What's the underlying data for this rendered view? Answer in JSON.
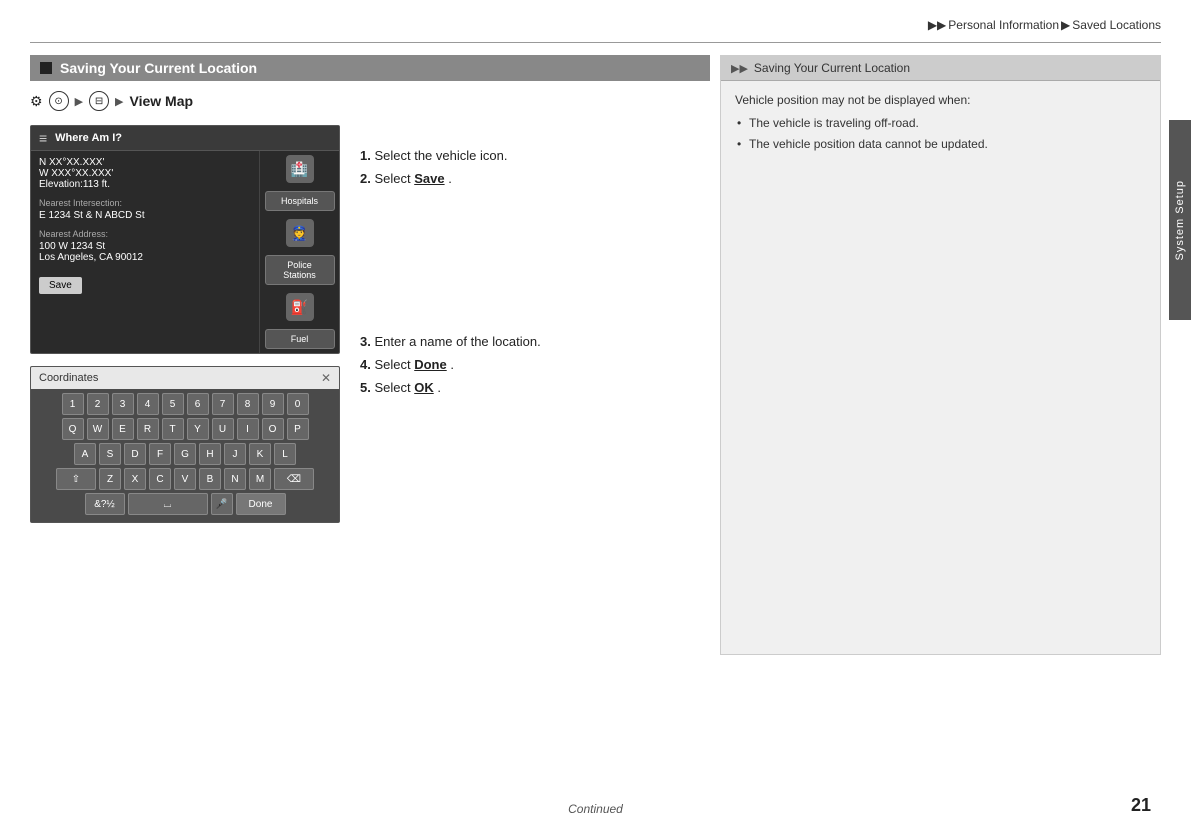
{
  "breadcrumb": {
    "arrow1": "▶▶",
    "section1": "Personal Information",
    "arrow2": "▶",
    "section2": "Saved Locations"
  },
  "top_divider": true,
  "page_number": "21",
  "continued_label": "Continued",
  "sidebar_tab": "System Setup",
  "main_section": {
    "header_icon": "■",
    "header_title": "Saving Your Current Location",
    "nav_icons": "⚙ ⊙ ▶ ⊟ ▶",
    "nav_label": "View Map",
    "screen1": {
      "title": "Where Am I?",
      "coords_label": "N XX°XX.XXX'",
      "coords_label2": "W XXX°XX.XXX'",
      "elevation": "Elevation:113 ft.",
      "nearest_intersection_label": "Nearest Intersection:",
      "nearest_intersection": "E 1234 St & N ABCD St",
      "nearest_address_label": "Nearest Address:",
      "nearest_address1": "100 W 1234 St",
      "nearest_address2": "Los Angeles, CA 90012",
      "save_button": "Save",
      "side_btn1": "Hospitals",
      "side_btn2": "Police Stations",
      "side_btn3": "Fuel"
    },
    "screen2": {
      "input_placeholder": "Coordinates",
      "close_icon": "✕",
      "rows": [
        [
          "1",
          "2",
          "3",
          "4",
          "5",
          "6",
          "7",
          "8",
          "9",
          "0"
        ],
        [
          "Q",
          "W",
          "E",
          "R",
          "T",
          "Y",
          "U",
          "I",
          "O",
          "P"
        ],
        [
          "A",
          "S",
          "D",
          "F",
          "G",
          "H",
          "J",
          "K",
          "L"
        ],
        [
          "⇧",
          "Z",
          "X",
          "C",
          "V",
          "B",
          "N",
          "M",
          "⌫"
        ]
      ],
      "bottom_row": [
        "&?½",
        "⌴",
        "🎤",
        "Done"
      ]
    },
    "instructions": [
      {
        "num": "1.",
        "text": "Select the vehicle icon."
      },
      {
        "num": "2.",
        "text": "Select ",
        "bold": "Save",
        "text2": "."
      },
      {
        "num": "3.",
        "text": "Enter a name of the location."
      },
      {
        "num": "4.",
        "text": "Select ",
        "bold": "Done",
        "text2": "."
      },
      {
        "num": "5.",
        "text": "Select ",
        "bold": "OK",
        "text2": "."
      }
    ]
  },
  "right_panel": {
    "arrow": "▶▶",
    "title": "Saving Your Current Location",
    "body_text": "Vehicle position may not be displayed when:",
    "bullets": [
      "The vehicle is traveling off-road.",
      "The vehicle position data cannot be updated."
    ]
  }
}
